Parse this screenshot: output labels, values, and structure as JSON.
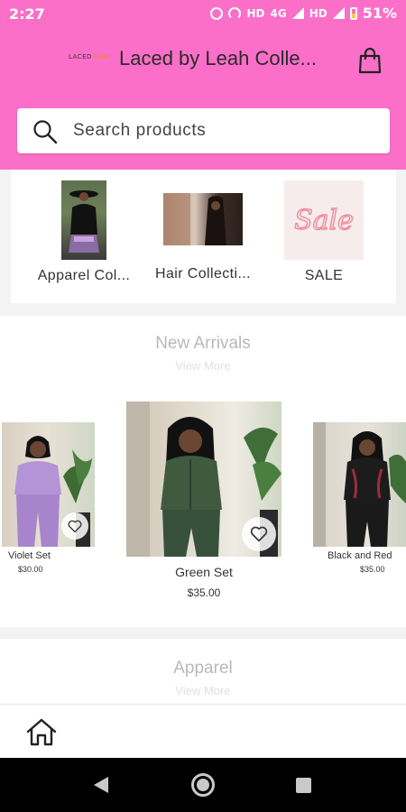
{
  "status_bar": {
    "time": "2:27",
    "network_1": "HD",
    "network_2": "4G",
    "network_3": "HD",
    "battery": "51%"
  },
  "header": {
    "logo_text_1": "LACED",
    "logo_text_2": "LEAH",
    "title": "Laced by Leah Colle...",
    "cart_icon": "shopping-bag-icon",
    "background": "#fb6fc8"
  },
  "search": {
    "placeholder": "Search products",
    "icon": "search-icon"
  },
  "collections": [
    {
      "label": "Apparel Col..."
    },
    {
      "label": "Hair Collecti..."
    },
    {
      "label": "SALE",
      "thumb_text": "Sale"
    }
  ],
  "new_arrivals": {
    "title": "New Arrivals",
    "view_more": "View More",
    "products": [
      {
        "name": "Violet Set",
        "price": "$30.00",
        "color": "#b493d6"
      },
      {
        "name": "Green Set",
        "price": "$35.00",
        "color": "#3f5a3f"
      },
      {
        "name": "Black and Red",
        "price": "$35.00",
        "color": "#1c1c1c"
      }
    ]
  },
  "apparel": {
    "title": "Apparel",
    "view_more": "View More"
  },
  "bottom_nav": {
    "home_icon": "home-icon"
  }
}
